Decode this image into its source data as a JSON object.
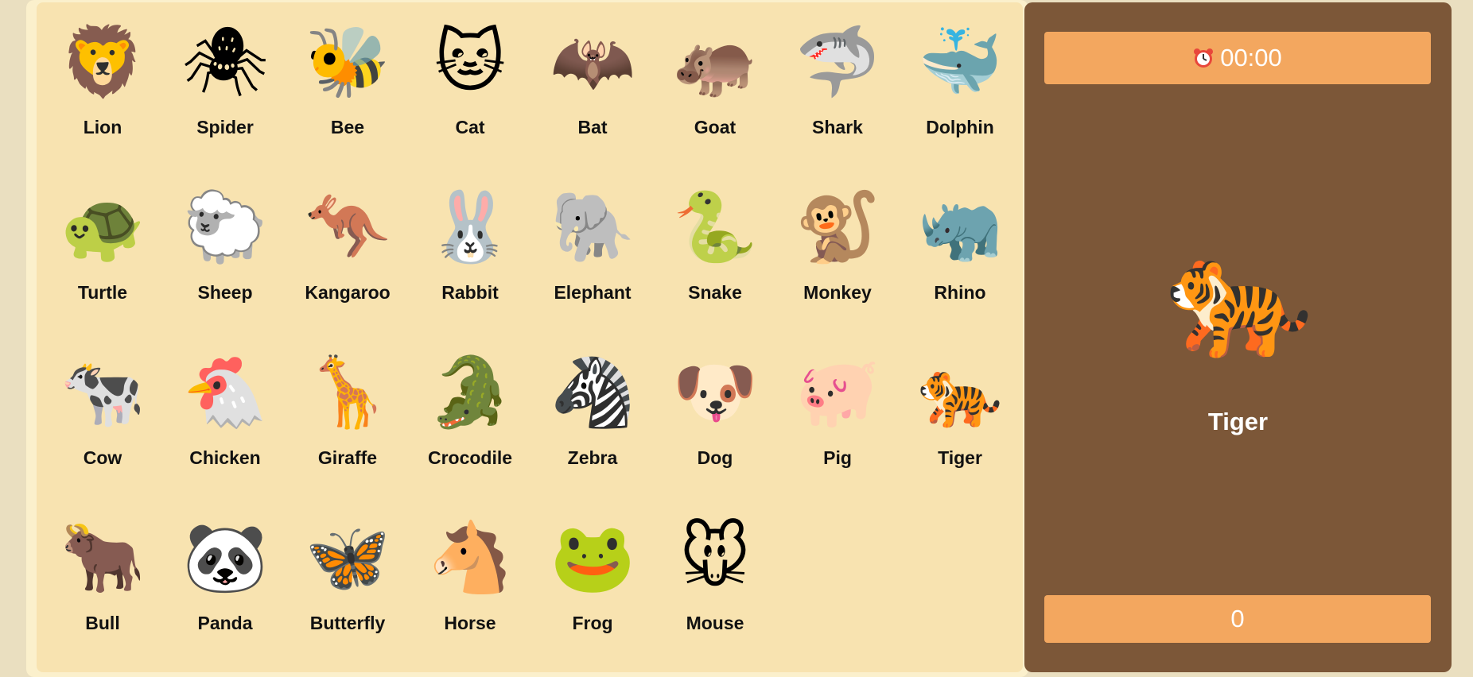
{
  "animals": [
    {
      "name": "Lion",
      "icon": "🦁"
    },
    {
      "name": "Spider",
      "icon": "🕷"
    },
    {
      "name": "Bee",
      "icon": "🐝"
    },
    {
      "name": "Cat",
      "icon": "🐱"
    },
    {
      "name": "Bat",
      "icon": "🦇"
    },
    {
      "name": "Goat",
      "icon": "🦛"
    },
    {
      "name": "Shark",
      "icon": "🦈"
    },
    {
      "name": "Dolphin",
      "icon": "🐳"
    },
    {
      "name": "Turtle",
      "icon": "🐢"
    },
    {
      "name": "Sheep",
      "icon": "🐑"
    },
    {
      "name": "Kangaroo",
      "icon": "🦘"
    },
    {
      "name": "Rabbit",
      "icon": "🐰"
    },
    {
      "name": "Elephant",
      "icon": "🐘"
    },
    {
      "name": "Snake",
      "icon": "🐍"
    },
    {
      "name": "Monkey",
      "icon": "🐒"
    },
    {
      "name": "Rhino",
      "icon": "🦏"
    },
    {
      "name": "Cow",
      "icon": "🐄"
    },
    {
      "name": "Chicken",
      "icon": "🐔"
    },
    {
      "name": "Giraffe",
      "icon": "🦒"
    },
    {
      "name": "Crocodile",
      "icon": "🐊"
    },
    {
      "name": "Zebra",
      "icon": "🦓"
    },
    {
      "name": "Dog",
      "icon": "🐶"
    },
    {
      "name": "Pig",
      "icon": "🐖"
    },
    {
      "name": "Tiger",
      "icon": "🐅"
    },
    {
      "name": "Bull",
      "icon": "🐂"
    },
    {
      "name": "Panda",
      "icon": "🐼"
    },
    {
      "name": "Butterfly",
      "icon": "🦋"
    },
    {
      "name": "Horse",
      "icon": "🐴"
    },
    {
      "name": "Frog",
      "icon": "🐸"
    },
    {
      "name": "Mouse",
      "icon": "🐭"
    }
  ],
  "side": {
    "timer": "00:00",
    "target_name": "Tiger",
    "target_icon": "🐅",
    "score": "0"
  },
  "colors": {
    "grid_bg": "#f8e3b0",
    "side_bg": "#7c5738",
    "bar_bg": "#f3a75f",
    "clock_red": "#e8473b"
  }
}
